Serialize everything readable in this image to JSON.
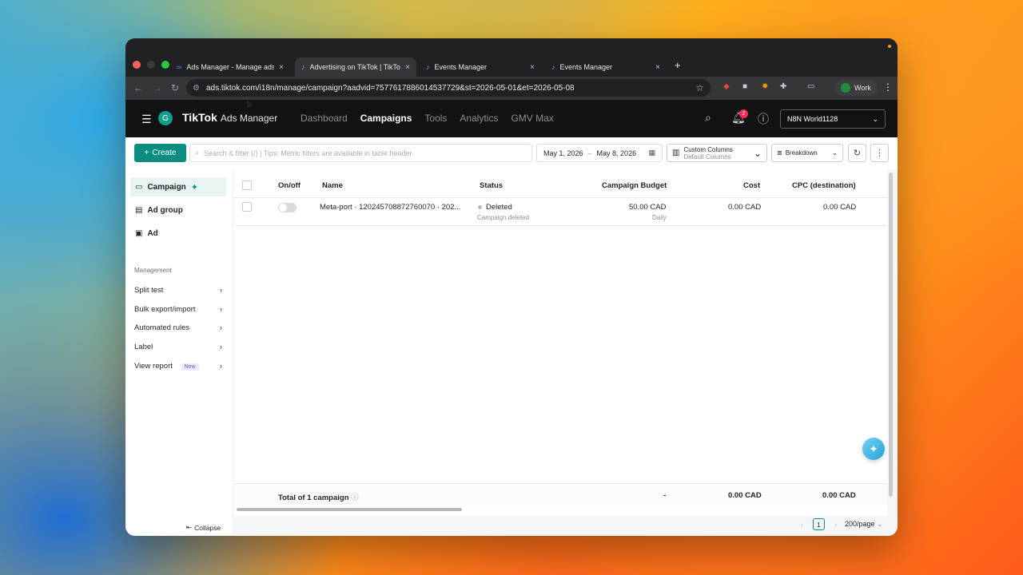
{
  "browser": {
    "tabs": [
      {
        "label": "Ads Manager - Manage ads -",
        "icon": "meta-icon"
      },
      {
        "label": "Advertising on TikTok | TikTok",
        "icon": "tiktok-icon"
      },
      {
        "label": "Events Manager",
        "icon": "tiktok-icon"
      },
      {
        "label": "Events Manager",
        "icon": "tiktok-icon"
      }
    ],
    "new_tab": "+",
    "url": "ads.tiktok.com/i18n/manage/campaign?aadvid=7577617886014537729&st=2026-05-01&et=2026-05-08",
    "profile": "Work",
    "close_glyph": "×"
  },
  "header": {
    "avatar_letter": "G",
    "brand_name": "TikTok",
    "brand_product": "Ads Manager",
    "nav": [
      "Dashboard",
      "Campaigns",
      "Tools",
      "Analytics",
      "GMV Max"
    ],
    "notification_count": "2",
    "account": "N8N World1128"
  },
  "toolbar": {
    "create_label": "Create",
    "search_placeholder": "Search & filter (/) | Tips: Metric filters are available in table header",
    "date_start": "May 1, 2026",
    "date_sep": "–",
    "date_end": "May 8, 2026",
    "custom_columns_title": "Custom Columns",
    "custom_columns_sub": "Default Columns",
    "breakdown_label": "Breakdown"
  },
  "sidebar": {
    "levels": [
      "Campaign",
      "Ad group",
      "Ad"
    ],
    "management_heading": "Management",
    "items": [
      {
        "label": "Split test"
      },
      {
        "label": "Bulk export/import"
      },
      {
        "label": "Automated rules"
      },
      {
        "label": "Label"
      },
      {
        "label": "View report",
        "badge": "New"
      }
    ],
    "collapse_label": "Collapse"
  },
  "table": {
    "headers": {
      "onoff": "On/off",
      "name": "Name",
      "status": "Status",
      "budget": "Campaign Budget",
      "cost": "Cost",
      "cpc": "CPC (destination)"
    },
    "rows": [
      {
        "name": "Meta-port · 120245708872760070 · 202...",
        "status": "Deleted",
        "status_sub": "Campaign deleted",
        "budget": "50.00 CAD",
        "budget_sub": "Daily",
        "cost": "0.00 CAD",
        "cpc": "0.00 CAD"
      }
    ],
    "total_label": "Total of 1 campaign",
    "total_budget": "-",
    "total_cost": "0.00 CAD",
    "total_cpc": "0.00 CAD"
  },
  "pagination": {
    "current_page": "1",
    "page_size": "200/page"
  },
  "colors": {
    "accent": "#0b8e80",
    "badge_red": "#fe2c55"
  }
}
